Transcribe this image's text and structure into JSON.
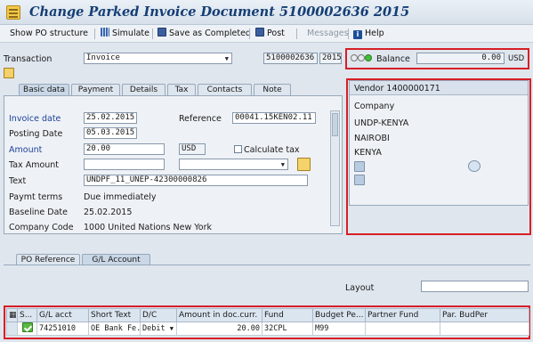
{
  "window": {
    "title": "Change Parked Invoice Document 5100002636 2015"
  },
  "toolbar": {
    "show_po": "Show PO structure",
    "simulate": "Simulate",
    "save_completed": "Save as Completed",
    "post": "Post",
    "messages": "Messages",
    "help": "Help"
  },
  "header": {
    "transaction_label": "Transaction",
    "transaction_value": "Invoice",
    "doc_number": "5100002636",
    "year": "2015",
    "balance_label": "Balance",
    "balance_value": "0.00",
    "balance_currency": "USD"
  },
  "tabs": [
    "Basic data",
    "Payment",
    "Details",
    "Tax",
    "Contacts",
    "Note"
  ],
  "basic": {
    "invoice_date_label": "Invoice date",
    "invoice_date": "25.02.2015",
    "reference_label": "Reference",
    "reference": "00041.15KEN02.11",
    "posting_date_label": "Posting Date",
    "posting_date": "05.03.2015",
    "amount_label": "Amount",
    "amount": "20.00",
    "currency": "USD",
    "calc_tax": "Calculate tax",
    "tax_amount_label": "Tax Amount",
    "text_label": "Text",
    "text": "UNDPF_11_UNEP-42300000826",
    "paymt_label": "Paymt terms",
    "paymt": "Due immediately",
    "baseline_label": "Baseline Date",
    "baseline": "25.02.2015",
    "company_label": "Company Code",
    "company": "1000 United Nations New York"
  },
  "vendor": {
    "title": "Vendor 1400000171",
    "lines": [
      "Company",
      "UNDP-KENYA",
      "NAIROBI",
      "KENYA"
    ]
  },
  "lower_tabs": [
    "PO Reference",
    "G/L Account"
  ],
  "layout_label": "Layout",
  "grid": {
    "headers": [
      "S...",
      "G/L acct",
      "Short Text",
      "D/C",
      "Amount in doc.curr.",
      "Fund",
      "Budget Pe...",
      "Partner Fund",
      "Par. BudPer"
    ],
    "rows": [
      {
        "gl": "74251010",
        "short_text": "OE Bank Fe...",
        "dc": "Debit",
        "amount": "20.00",
        "fund": "32CPL",
        "budget": "M99"
      }
    ]
  },
  "colors": {
    "highlight": "#d81e26",
    "title": "#153e75"
  }
}
